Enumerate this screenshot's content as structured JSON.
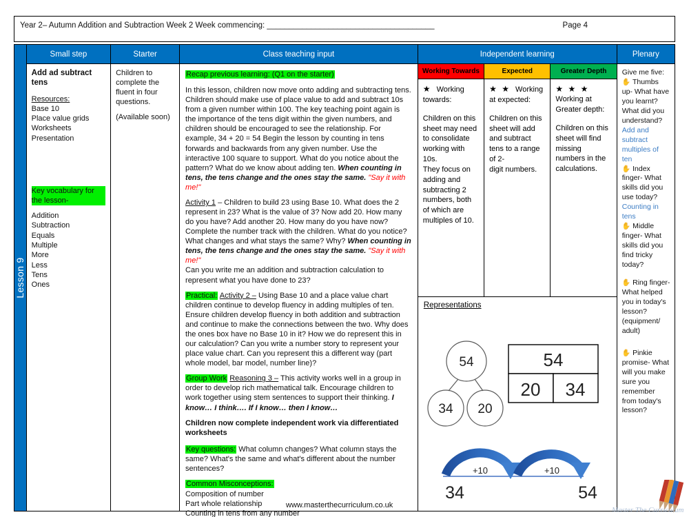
{
  "header": {
    "title_line": "Year 2– Autumn Addition and Subtraction Week 2   Week commencing: ______________________________________",
    "page_label": "Page 4"
  },
  "lesson_tab": {
    "label": "Lesson 9"
  },
  "columns": {
    "small_step": "Small step",
    "starter": "Starter",
    "teaching": "Class teaching input",
    "independent": "Independent learning",
    "plenary": "Plenary"
  },
  "small_step": {
    "title": "Add ad subtract tens",
    "resources_heading": "Resources:",
    "resources": [
      "Base 10",
      "Place value grids",
      "Worksheets",
      "Presentation"
    ],
    "vocab_heading": "Key vocabulary for the lesson-",
    "vocab": [
      "Addition",
      "Subtraction",
      "Equals",
      "Multiple",
      "More",
      "Less",
      "Tens",
      "Ones"
    ]
  },
  "starter": {
    "line1": "Children to complete the fluent in four questions.",
    "line2": "(Available soon)"
  },
  "teaching": {
    "recap_heading": "Recap previous learning: (Q1 on the starter)",
    "recap_body_1": "In this lesson, children now move onto adding and subtracting tens. Children should make use of place value to add and subtract 10s from a given number within 100. The key teaching point again is the importance of the tens digit within the given numbers, and children should be encouraged to see the relationship. For example, 34 + 20 = 54 Begin the lesson by counting in tens forwards and backwards from any given number. Use the interactive 100 square to support.  What do you notice about the pattern?  What do we know about adding ten. ",
    "recap_bold_1": "When counting in tens, the tens change and the ones stay the same.",
    "recap_red_1": " \"Say it with me!\"",
    "activity1_label": "Activity 1",
    "activity1_body_a": " – Children to build 23 using Base 10.  What does the 2 represent in 23?  What is the value of 3?  Now add 20.  How many do you have?  Add another 20. How many do you have now?  Complete the number track with the children.  What do you notice? What changes and what stays the same?  Why? ",
    "activity1_bold": "When counting in tens, the tens change and the ones stay the same.",
    "activity1_red": " \"Say it with me!\"",
    "activity1_body_b": "Can you write me an addition and subtraction calculation to represent what you have done to 23?",
    "practical_tag": "Practical:",
    "activity2_label": "Activity 2 –",
    "activity2_body": " Using Base 10 and a place value chart children continue to develop fluency in adding multiples of ten.  Ensure children develop fluency in both addition and subtraction and continue to make the connections between the two.  Why does the ones box have no Base 10 in it?  How we do represent this in our calculation? Can you write a number story to represent your place value chart.  Can you represent this a different way (part whole model, bar model, number line)?",
    "groupwork_tag": "Group Work",
    "reasoning_label": "Reasoning 3 –",
    "reasoning_body": " This activity works well in a group in order to develop rich mathematical talk. Encourage children to work together using stem sentences to support their thinking. ",
    "reasoning_stems": "I know… I think…. If I know… then I know…",
    "independent_note": "Children now complete independent work via differentiated  worksheets",
    "key_questions_tag": "Key questions:",
    "key_questions_body": " What column changes? What column stays the same? What's the same and what's different about the number sentences?",
    "misconceptions_tag": "Common Misconceptions:",
    "misconceptions": [
      "Composition of number",
      "Part whole relationship",
      "Counting in tens from any number"
    ]
  },
  "independent": {
    "bands": [
      {
        "label": "Working Towards",
        "color": "#FF0000"
      },
      {
        "label": "Expected",
        "color": "#FFC000"
      },
      {
        "label": "Greater Depth",
        "color": "#00B050"
      }
    ],
    "levels": [
      {
        "stars": "★",
        "heading": "Working towards:",
        "body": "Children on this sheet may need to consolidate working with 10s.\nThey focus on adding and subtracting 2 numbers, both of which are multiples of 10."
      },
      {
        "stars": "★ ★",
        "heading": "Working at expected:",
        "body": "Children on this sheet will add and subtract tens to a range of 2-\ndigit numbers."
      },
      {
        "stars": "★ ★ ★",
        "heading": "Working at Greater depth:",
        "body": "Children on this sheet will find missing numbers in the calculations."
      }
    ],
    "representations_label": "Representations",
    "part_whole": {
      "whole": "54",
      "part_left": "34",
      "part_right": "20"
    },
    "bar_model": {
      "whole": "54",
      "left": "20",
      "right": "34"
    },
    "number_line": {
      "start": "34",
      "end": "54",
      "jump1": "+10",
      "jump2": "+10"
    }
  },
  "plenary": {
    "intro": "Give me five:",
    "items": [
      {
        "icon": "hand-icon",
        "text": "Thumbs up- What have you learnt? What did you understand?",
        "answer": "Add and subtract multiples of ten"
      },
      {
        "icon": "hand-icon",
        "text": "Index finger- What skills did you use today?",
        "answer": "Counting in tens"
      },
      {
        "icon": "hand-icon",
        "text": "Middle finger- What skills did you find tricky today?",
        "answer": ""
      },
      {
        "icon": "hand-icon",
        "text": "Ring finger- What helped you in today's lesson? (equipment/ adult)",
        "answer": ""
      },
      {
        "icon": "hand-icon",
        "text": "Pinkie promise- What will you make sure you remember from today's lesson?",
        "answer": ""
      }
    ]
  },
  "footer": {
    "url": "www.masterthecurriculum.co.uk"
  },
  "colors": {
    "header_blue": "#0070C0",
    "highlight_green": "#00F000",
    "red_text": "#FF0000",
    "blue_text": "#3B7CC4",
    "arrow_blue": "#2E5FA3"
  }
}
